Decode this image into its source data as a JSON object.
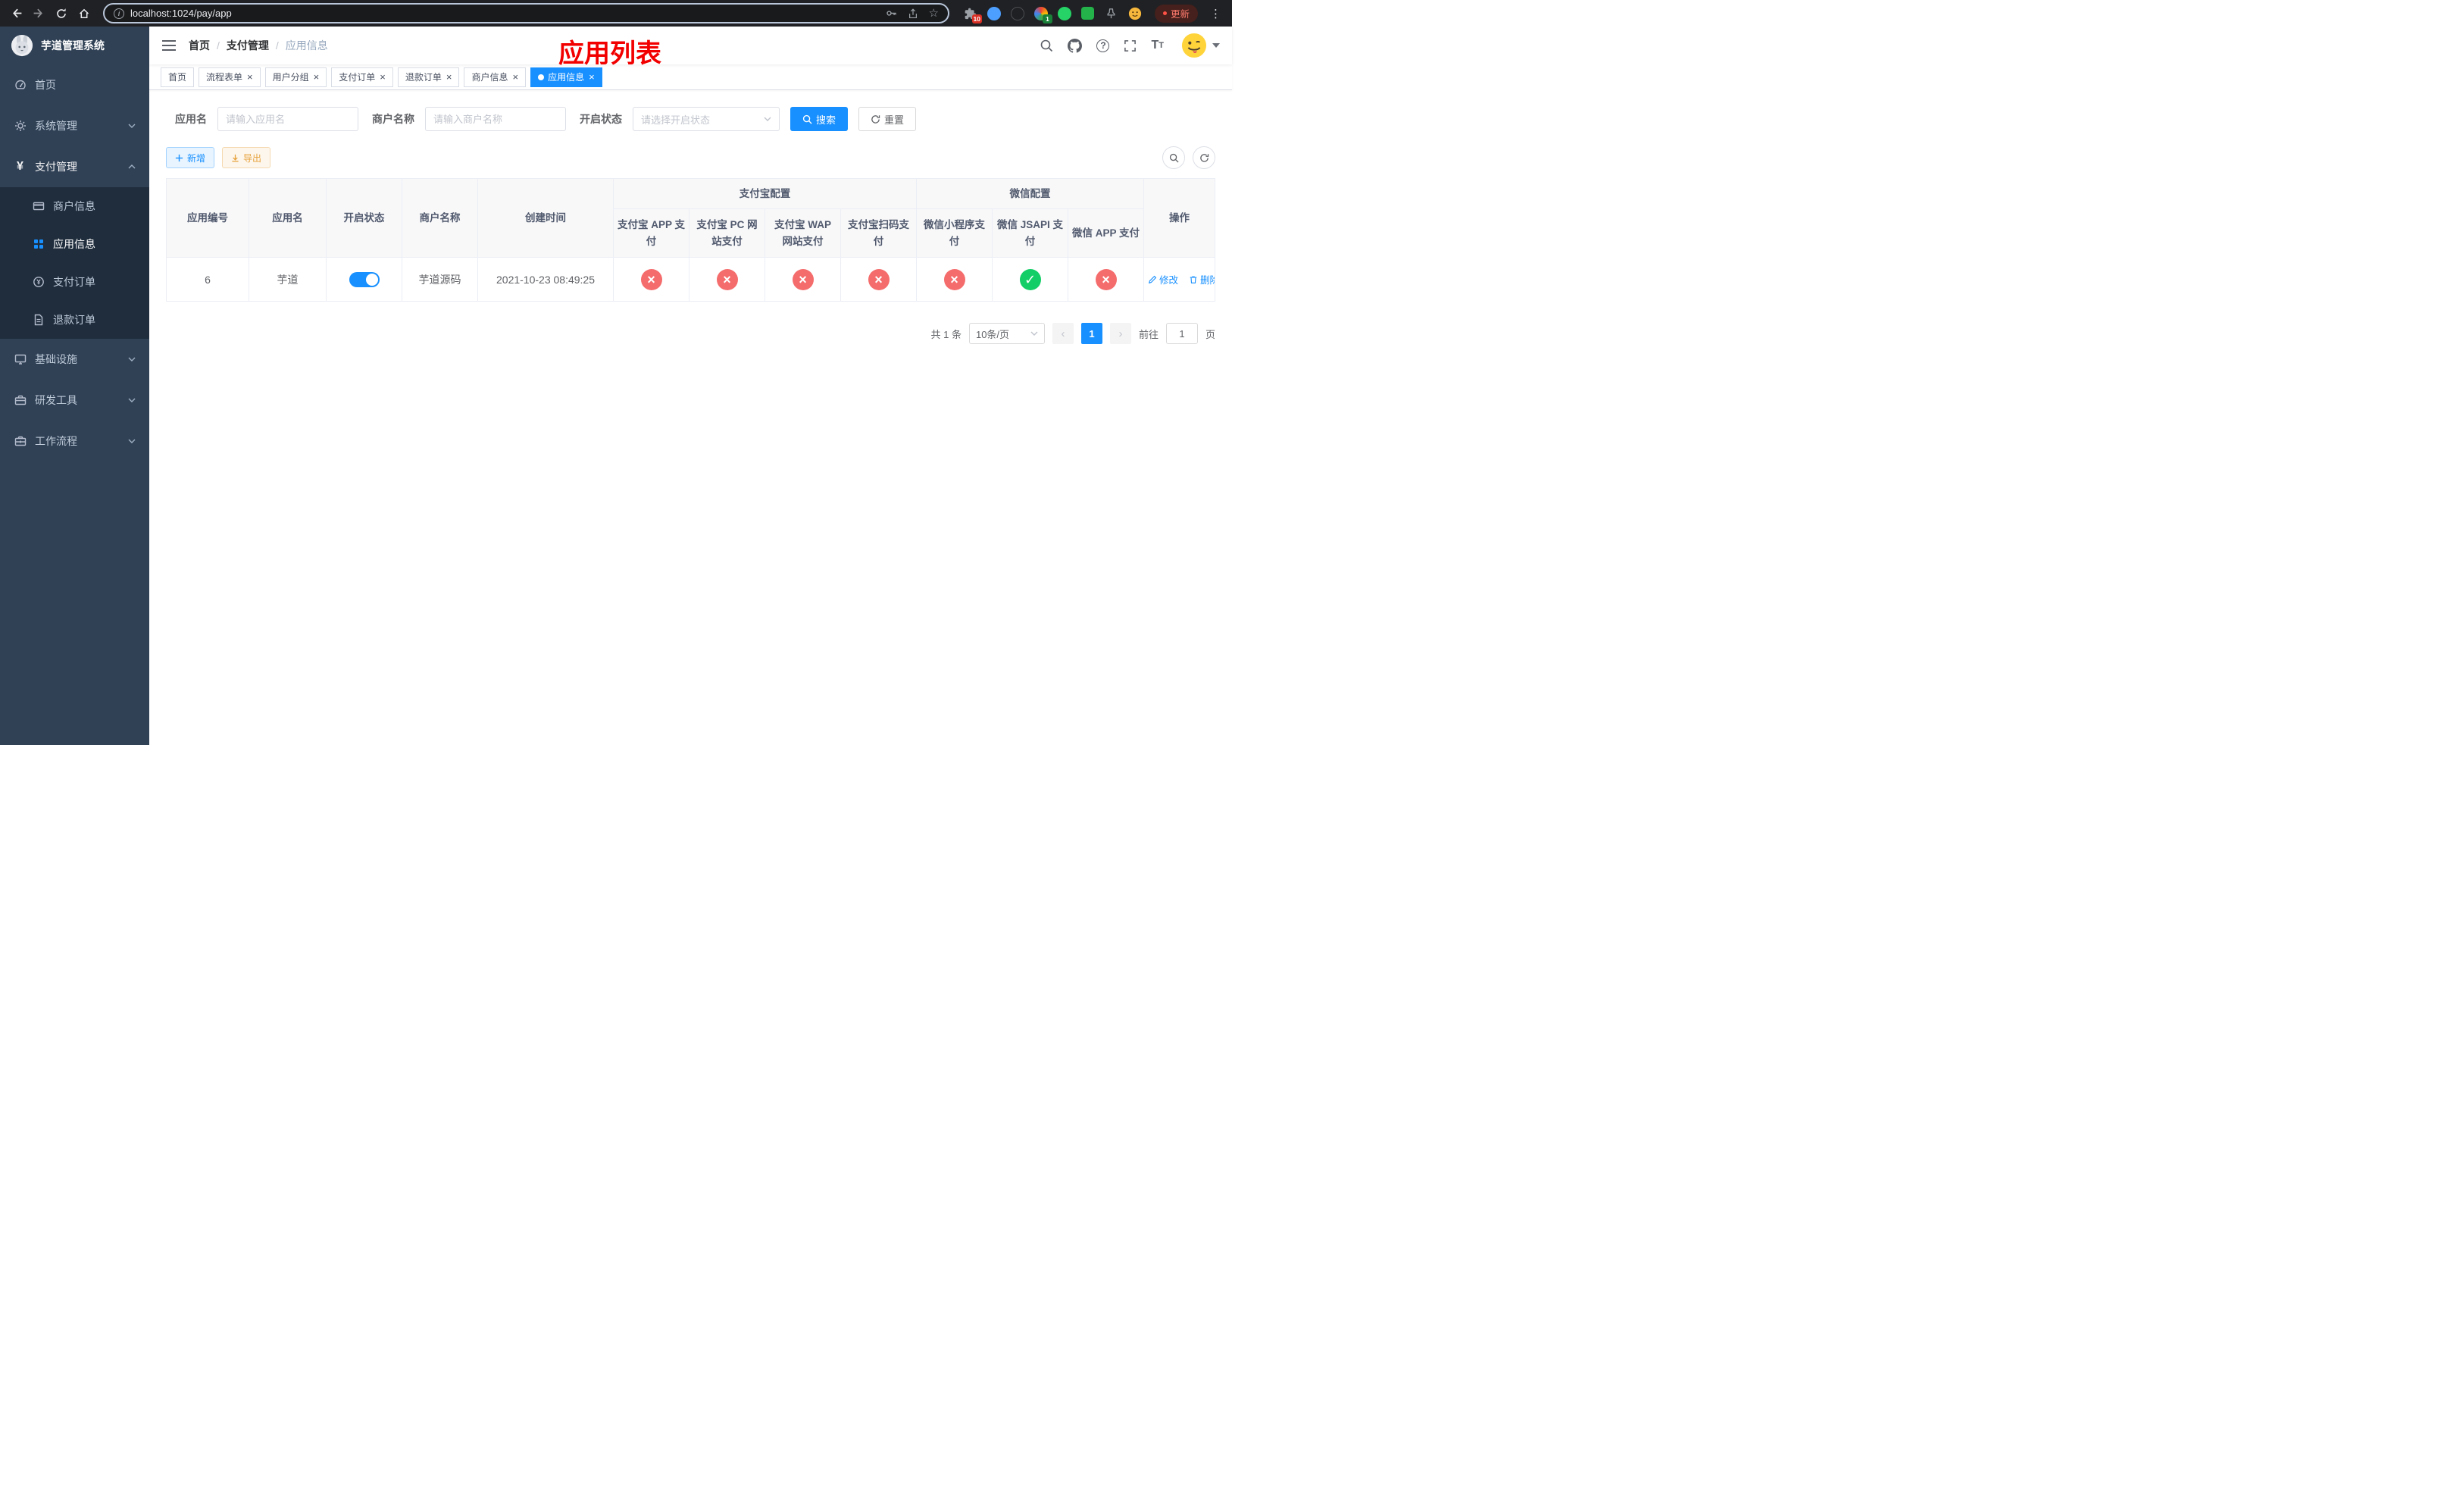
{
  "browser": {
    "url": "localhost:1024/pay/app",
    "update_label": "更新",
    "extension_badge_puzzle": "10",
    "extension_badge_green": "1"
  },
  "sidebar": {
    "logo_title": "芋道管理系统",
    "items": [
      {
        "label": "首页"
      },
      {
        "label": "系统管理"
      },
      {
        "label": "支付管理"
      },
      {
        "label": "基础设施"
      },
      {
        "label": "研发工具"
      },
      {
        "label": "工作流程"
      }
    ],
    "payment_children": [
      {
        "label": "商户信息"
      },
      {
        "label": "应用信息"
      },
      {
        "label": "支付订单"
      },
      {
        "label": "退款订单"
      }
    ]
  },
  "header": {
    "breadcrumb": [
      "首页",
      "支付管理",
      "应用信息"
    ],
    "annotation": "应用列表"
  },
  "tabs": [
    {
      "label": "首页",
      "closable": false
    },
    {
      "label": "流程表单",
      "closable": true
    },
    {
      "label": "用户分组",
      "closable": true
    },
    {
      "label": "支付订单",
      "closable": true
    },
    {
      "label": "退款订单",
      "closable": true
    },
    {
      "label": "商户信息",
      "closable": true
    },
    {
      "label": "应用信息",
      "closable": true,
      "active": true
    }
  ],
  "filters": {
    "app_name_label": "应用名",
    "app_name_placeholder": "请输入应用名",
    "merchant_label": "商户名称",
    "merchant_placeholder": "请输入商户名称",
    "status_label": "开启状态",
    "status_placeholder": "请选择开启状态",
    "search_label": "搜索",
    "reset_label": "重置"
  },
  "toolbar": {
    "add_label": "新增",
    "export_label": "导出"
  },
  "table": {
    "group_headers": {
      "alipay": "支付宝配置",
      "wechat": "微信配置"
    },
    "columns": [
      "应用编号",
      "应用名",
      "开启状态",
      "商户名称",
      "创建时间"
    ],
    "alipay_columns": [
      "支付宝 APP 支付",
      "支付宝 PC 网站支付",
      "支付宝 WAP 网站支付",
      "支付宝扫码支付"
    ],
    "wechat_columns": [
      "微信小程序支付",
      "微信 JSAPI 支付",
      "微信 APP 支付"
    ],
    "actions_column": "操作",
    "rows": [
      {
        "app_id": "6",
        "app_name": "芋道",
        "status_on": true,
        "merchant_name": "芋道源码",
        "created_at": "2021-10-23 08:49:25",
        "configs": [
          "no",
          "no",
          "no",
          "no",
          "no",
          "yes",
          "no"
        ],
        "edit_label": "修改",
        "delete_label": "删除"
      }
    ]
  },
  "pagination": {
    "total_label": "共 1 条",
    "page_size_label": "10条/页",
    "page": "1",
    "goto_prefix": "前往",
    "goto_value": "1",
    "goto_suffix": "页"
  },
  "colors": {
    "primary": "#1890ff",
    "success": "#13ce66",
    "danger": "#f56c6c",
    "warning": "#e6a23c",
    "annotation_red": "#f20000",
    "sidebar_bg": "#304156",
    "submenu_bg": "#1f2d3d"
  }
}
